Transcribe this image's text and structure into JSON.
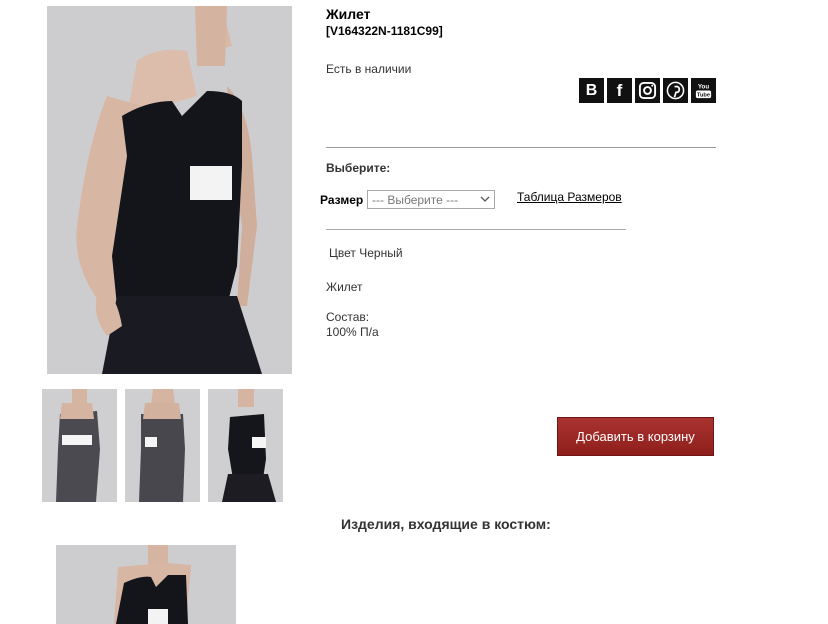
{
  "product": {
    "title": "Жилет",
    "sku": "[V164322N-1181C99]",
    "stock": "Есть в наличии",
    "choose_label": "Выберите:",
    "size_label": "Размер",
    "size_select_value": "--- Выберите ---",
    "size_chart_link": "Таблица Размеров",
    "color_text": "Цвет Черный",
    "description": "Жилет",
    "composition_label": "Состав:",
    "composition_value": "100% П/а",
    "add_to_cart": "Добавить в корзину"
  },
  "social": [
    {
      "icon": "vk-icon",
      "glyph": "B"
    },
    {
      "icon": "facebook-icon",
      "glyph": "f"
    },
    {
      "icon": "instagram-icon",
      "glyph": ""
    },
    {
      "icon": "pinterest-icon",
      "glyph": ""
    },
    {
      "icon": "youtube-icon",
      "glyph": ""
    }
  ],
  "suit": {
    "heading": "Изделия, входящие в костюм:"
  },
  "colors": {
    "button": "#9b2421",
    "photo_bg": "#c9c9cb",
    "garment": "#111118",
    "belt": "#f2f2f2"
  }
}
